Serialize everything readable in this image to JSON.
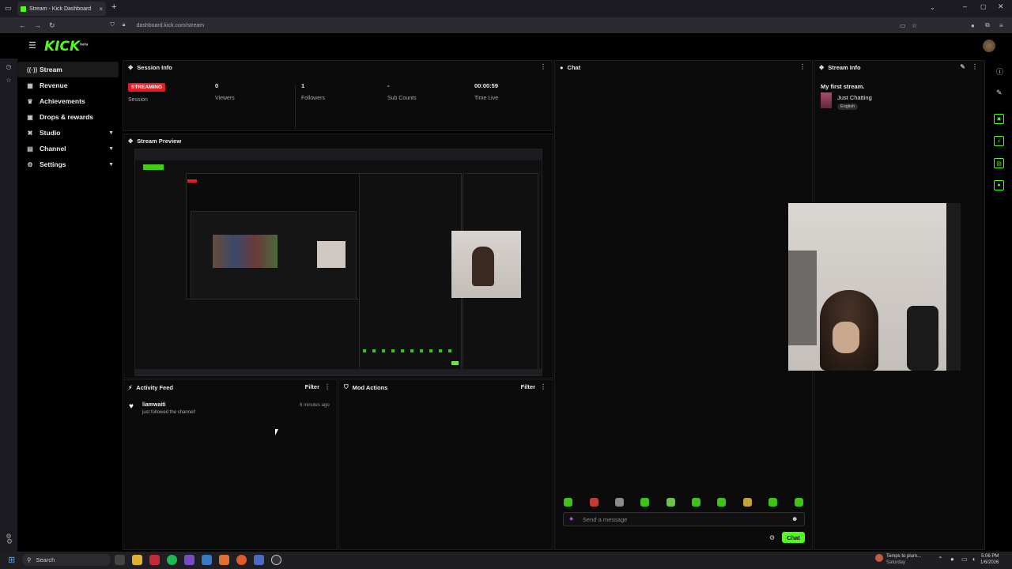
{
  "browser": {
    "tab_title": "Stream - Kick Dashboard",
    "tab_close": "×",
    "new_tab": "+",
    "url": "dashboard.kick.com/stream"
  },
  "app": {
    "logo": "KICK",
    "logo_badge": "beta"
  },
  "sidebar": {
    "items": [
      {
        "label": "Stream",
        "icon": "broadcast-icon",
        "active": true
      },
      {
        "label": "Revenue",
        "icon": "revenue-icon"
      },
      {
        "label": "Achievements",
        "icon": "trophy-icon"
      },
      {
        "label": "Drops & rewards",
        "icon": "gift-icon"
      },
      {
        "label": "Studio",
        "icon": "studio-icon",
        "expandable": true
      },
      {
        "label": "Channel",
        "icon": "channel-icon",
        "expandable": true
      },
      {
        "label": "Settings",
        "icon": "gear-icon",
        "expandable": true
      }
    ]
  },
  "session_info": {
    "title": "Session Info",
    "status_badge": "STREAMING",
    "status_label": "Session",
    "stats": [
      {
        "value": "0",
        "label": "Viewers"
      },
      {
        "value": "1",
        "label": "Followers"
      },
      {
        "value": "-",
        "label": "Sub Counts"
      },
      {
        "value": "00:00:59",
        "label": "Time Live"
      }
    ]
  },
  "stream_preview": {
    "title": "Stream Preview"
  },
  "activity_feed": {
    "title": "Activity Feed",
    "filter_label": "Filter",
    "events": [
      {
        "user": "liamwaiti",
        "text": "just followed the channel!",
        "time": "6 minutes ago"
      }
    ]
  },
  "mod_actions": {
    "title": "Mod Actions",
    "filter_label": "Filter"
  },
  "chat": {
    "title": "Chat",
    "input_placeholder": "Send a message",
    "send_label": "Chat"
  },
  "stream_info": {
    "title": "Stream Info",
    "stream_title": "My first stream.",
    "category": "Just Chatting",
    "language": "English"
  },
  "taskbar": {
    "search_placeholder": "Search",
    "weather_text": "Temps to plum...",
    "weather_sub": "Saturday",
    "time": "5:06 PM",
    "date": "1/6/2026"
  },
  "colors": {
    "brand": "#53fc18",
    "streaming_badge": "#e71b24",
    "panel_bg": "#0b0b0b"
  }
}
